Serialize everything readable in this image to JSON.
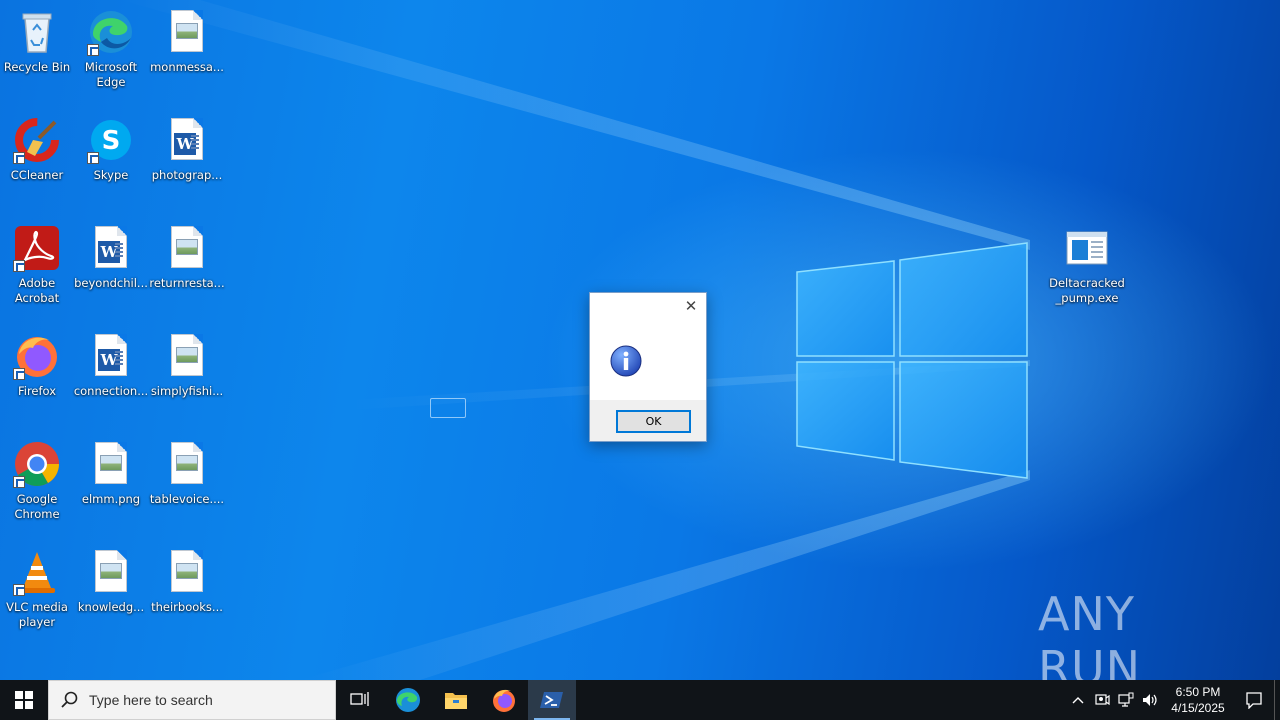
{
  "desktop": {
    "icons": [
      {
        "label": "Recycle Bin",
        "kind": "recycle-bin",
        "shortcut": false
      },
      {
        "label": "Microsoft Edge",
        "kind": "edge",
        "shortcut": true
      },
      {
        "label": "monmessa...",
        "kind": "image-file",
        "shortcut": false
      },
      {
        "label": "CCleaner",
        "kind": "ccleaner",
        "shortcut": true
      },
      {
        "label": "Skype",
        "kind": "skype",
        "shortcut": true
      },
      {
        "label": "photograp...",
        "kind": "word-file",
        "shortcut": false
      },
      {
        "label": "Adobe Acrobat",
        "kind": "acrobat",
        "shortcut": true
      },
      {
        "label": "beyondchil...",
        "kind": "word-file",
        "shortcut": false
      },
      {
        "label": "returnresta...",
        "kind": "image-file",
        "shortcut": false
      },
      {
        "label": "Firefox",
        "kind": "firefox",
        "shortcut": true
      },
      {
        "label": "connection...",
        "kind": "word-file",
        "shortcut": false
      },
      {
        "label": "simplyfishi...",
        "kind": "image-file",
        "shortcut": false
      },
      {
        "label": "Google Chrome",
        "kind": "chrome",
        "shortcut": true
      },
      {
        "label": "elmm.png",
        "kind": "image-file",
        "shortcut": false
      },
      {
        "label": "tablevoice....",
        "kind": "image-file",
        "shortcut": false
      },
      {
        "label": "VLC media player",
        "kind": "vlc",
        "shortcut": true
      },
      {
        "label": "knowledg...",
        "kind": "image-file",
        "shortcut": false
      },
      {
        "label": "theirbooks...",
        "kind": "image-file",
        "shortcut": false
      }
    ],
    "exe_icon": {
      "label": "Deltacracked_pump.exe",
      "kind": "exe-window-icon"
    }
  },
  "dialog": {
    "ok_label": "OK",
    "close_glyph": "✕",
    "icon": "information-icon"
  },
  "watermark": {
    "text": "ANY RUN"
  },
  "taskbar": {
    "search_placeholder": "Type here to search",
    "apps": [
      "task-view-icon",
      "edge-icon",
      "file-explorer-icon",
      "firefox-icon",
      "powershell-icon"
    ],
    "clock_time": "6:50 PM",
    "clock_date": "4/15/2025"
  },
  "colors": {
    "taskbar": "#101418",
    "accent": "#0078d7"
  }
}
